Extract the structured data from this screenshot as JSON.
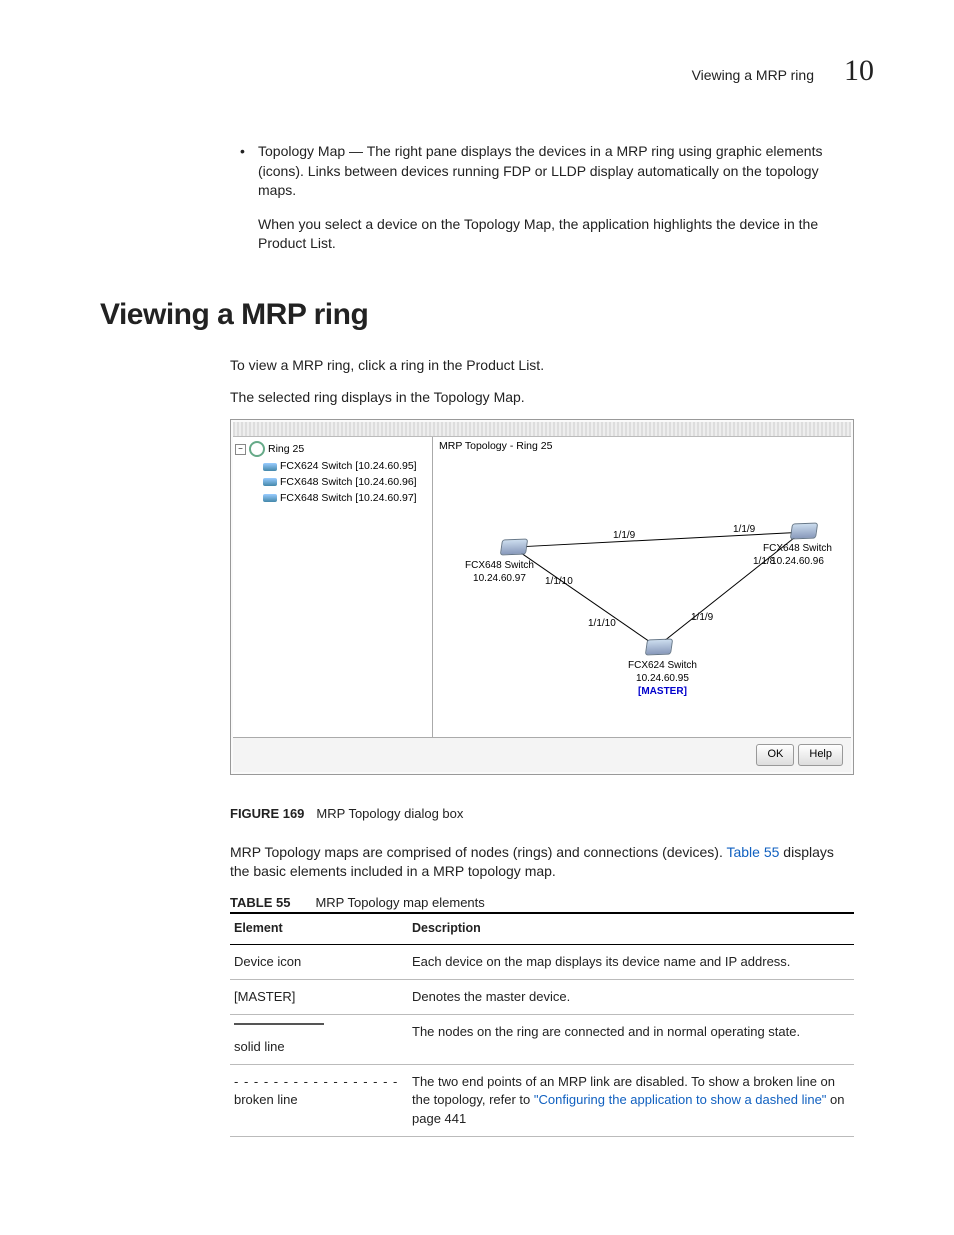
{
  "header": {
    "title": "Viewing a MRP ring",
    "chapter": "10"
  },
  "intro": {
    "bullet_para": "Topology Map — The right pane displays the devices in a MRP ring using graphic elements (icons). Links between devices running FDP or LLDP display automatically on the topology maps.",
    "bullet_follow": "When you select a device on the Topology Map, the application highlights the device in the Product List."
  },
  "section": {
    "h1": "Viewing a MRP ring",
    "p1": "To view a MRP ring, click a ring in the Product List.",
    "p2": "The selected ring displays in the Topology Map."
  },
  "dialog": {
    "tree_root": "Ring 25",
    "tree_items": [
      "FCX624 Switch [10.24.60.95]",
      "FCX648 Switch [10.24.60.96]",
      "FCX648 Switch [10.24.60.97]"
    ],
    "topo_title": "MRP Topology - Ring 25",
    "node_left": {
      "name": "FCX648 Switch",
      "ip": "10.24.60.97"
    },
    "node_right": {
      "name": "FCX648 Switch",
      "ip": "10.24.60.96"
    },
    "node_bottom": {
      "name": "FCX624 Switch",
      "ip": "10.24.60.95",
      "tag": "[MASTER]"
    },
    "edge_labels": {
      "top_left": "1/1/9",
      "top_right": "1/1/9",
      "right_down": "1/1/8",
      "bottom_right": "1/1/9",
      "bottom_left": "1/1/10",
      "left_down": "1/1/10"
    },
    "ok": "OK",
    "help": "Help"
  },
  "fig_caption": {
    "num": "FIGURE 169",
    "text": "MRP Topology dialog box"
  },
  "after_fig": {
    "p_pre": "MRP Topology maps are comprised of nodes (rings) and connections (devices). ",
    "link": "Table 55",
    "p_post": " displays the basic elements included in a MRP topology map."
  },
  "table_caption": {
    "num": "TABLE 55",
    "text": "MRP Topology map elements"
  },
  "table": {
    "hdr_el": "Element",
    "hdr_desc": "Description",
    "r1_el": "Device icon",
    "r1_desc": "Each device on the map displays its device name and IP address.",
    "r2_el": "[MASTER]",
    "r2_desc": "Denotes the master device.",
    "r3_el": "solid line",
    "r3_desc": "The nodes on the ring are connected and in normal operating state.",
    "r4_dash": "- - - - - - - - - - - - - - - - -",
    "r4_el": "broken line",
    "r4_desc_pre": "The two end points of an MRP link are disabled. To show a broken line on the topology, refer to ",
    "r4_link": "\"Configuring the application to show a dashed line\"",
    "r4_desc_post": " on page 441"
  }
}
